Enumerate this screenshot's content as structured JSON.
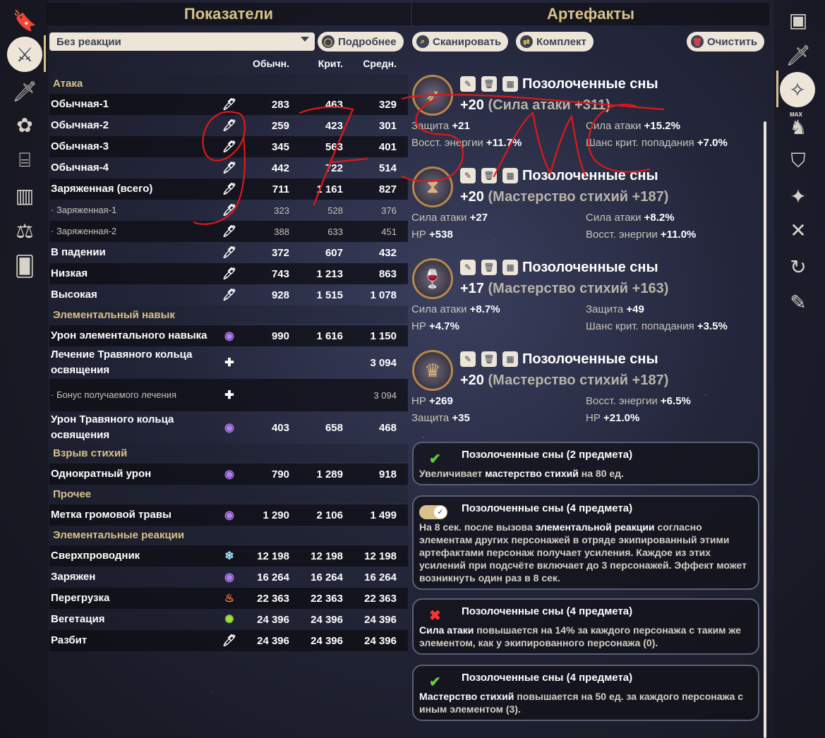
{
  "headers": {
    "stats": "Показатели",
    "artifacts": "Артефакты"
  },
  "reaction_select": {
    "value": "Без реакции"
  },
  "buttons": {
    "details": "Подробнее",
    "scan": "Сканировать",
    "set": "Комплект",
    "clear": "Очистить"
  },
  "columns": {
    "normal": "Обычн.",
    "crit": "Крит.",
    "avg": "Средн."
  },
  "sections": {
    "attack": "Атака",
    "skill": "Элементальный навык",
    "burst": "Взрыв стихий",
    "other": "Прочее",
    "reactions": "Элементальные реакции"
  },
  "attack_rows": [
    {
      "label": "Обычная-1",
      "icon": "sword-icon",
      "n": "283",
      "c": "463",
      "a": "329"
    },
    {
      "label": "Обычная-2",
      "icon": "sword-icon",
      "n": "259",
      "c": "423",
      "a": "301"
    },
    {
      "label": "Обычная-3",
      "icon": "sword-icon",
      "n": "345",
      "c": "563",
      "a": "401"
    },
    {
      "label": "Обычная-4",
      "icon": "sword-icon",
      "n": "442",
      "c": "722",
      "a": "514"
    },
    {
      "label": "Заряженная (всего)",
      "icon": "sword-icon",
      "n": "711",
      "c": "1 161",
      "a": "827"
    },
    {
      "label": "· Заряженная-1",
      "icon": "sword-icon",
      "n": "323",
      "c": "528",
      "a": "376"
    },
    {
      "label": "· Заряженная-2",
      "icon": "sword-icon",
      "n": "388",
      "c": "633",
      "a": "451"
    },
    {
      "label": "В падении",
      "icon": "sword-icon",
      "n": "372",
      "c": "607",
      "a": "432"
    },
    {
      "label": "Низкая",
      "icon": "sword-icon",
      "n": "743",
      "c": "1 213",
      "a": "863"
    },
    {
      "label": "Высокая",
      "icon": "sword-icon",
      "n": "928",
      "c": "1 515",
      "a": "1 078"
    }
  ],
  "skill_rows": [
    {
      "label": "Урон элементального навыка",
      "icon": "electro-icon",
      "n": "990",
      "c": "1 616",
      "a": "1 150"
    },
    {
      "label": "Лечение Травяного кольца освящения",
      "icon": "heal-icon",
      "n": "",
      "c": "",
      "a": "3 094"
    },
    {
      "label": "· Бонус получаемого лечения",
      "icon": "heal-icon",
      "n": "",
      "c": "",
      "a": "3 094"
    },
    {
      "label": "Урон Травяного кольца освящения",
      "icon": "electro-icon",
      "n": "403",
      "c": "658",
      "a": "468"
    }
  ],
  "burst_rows": [
    {
      "label": "Однократный урон",
      "icon": "electro-icon",
      "n": "790",
      "c": "1 289",
      "a": "918"
    }
  ],
  "other_rows": [
    {
      "label": "Метка громовой травы",
      "icon": "electro-icon",
      "n": "1 290",
      "c": "2 106",
      "a": "1 499"
    }
  ],
  "reaction_rows": [
    {
      "label": "Сверхпроводник",
      "icon": "cryo-icon",
      "n": "12 198",
      "c": "12 198",
      "a": "12 198"
    },
    {
      "label": "Заряжен",
      "icon": "electro-icon",
      "n": "16 264",
      "c": "16 264",
      "a": "16 264"
    },
    {
      "label": "Перегрузка",
      "icon": "pyro-icon",
      "n": "22 363",
      "c": "22 363",
      "a": "22 363"
    },
    {
      "label": "Вегетация",
      "icon": "dendro-icon",
      "n": "24 396",
      "c": "24 396",
      "a": "24 396"
    },
    {
      "label": "Разбит",
      "icon": "sword-icon",
      "n": "24 396",
      "c": "24 396",
      "a": "24 396"
    }
  ],
  "artifacts": [
    {
      "name": "Позолоченные сны",
      "level": "+20",
      "main": "(Сила атаки +311)",
      "icon": "plume-icon",
      "subs": [
        [
          "Защита",
          "+21"
        ],
        [
          "Сила атаки",
          "+15.2%"
        ],
        [
          "Восст. энергии",
          "+11.7%"
        ],
        [
          "Шанс крит. попадания",
          "+7.0%"
        ]
      ]
    },
    {
      "name": "Позолоченные сны",
      "level": "+20",
      "main": "(Мастерство стихий +187)",
      "icon": "sands-icon",
      "subs": [
        [
          "Сила атаки",
          "+27"
        ],
        [
          "Сила атаки",
          "+8.2%"
        ],
        [
          "HP",
          "+538"
        ],
        [
          "Восст. энергии",
          "+11.0%"
        ]
      ]
    },
    {
      "name": "Позолоченные сны",
      "level": "+17",
      "main": "(Мастерство стихий +163)",
      "icon": "goblet-icon",
      "subs": [
        [
          "Сила атаки",
          "+8.7%"
        ],
        [
          "Защита",
          "+49"
        ],
        [
          "HP",
          "+4.7%"
        ],
        [
          "Шанс крит. попадания",
          "+3.5%"
        ]
      ]
    },
    {
      "name": "Позолоченные сны",
      "level": "+20",
      "main": "(Мастерство стихий +187)",
      "icon": "circlet-icon",
      "subs": [
        [
          "HP",
          "+269"
        ],
        [
          "Восст. энергии",
          "+6.5%"
        ],
        [
          "Защита",
          "+35"
        ],
        [
          "HP",
          "+21.0%"
        ]
      ]
    }
  ],
  "set_bonuses": [
    {
      "title": "Позолоченные сны (2 предмета)",
      "state": "check",
      "text_html": "Увеличивает <b>мастерство стихий</b> на 80 ед."
    },
    {
      "title": "Позолоченные сны (4 предмета)",
      "state": "toggle",
      "text_html": "На 8 сек. после вызова <b>элементальной реакции</b> согласно элементам других персонажей в отряде экипированный этими артефактами персонаж получает усиления. Каждое из этих усилений при подсчёте включает до 3 персонажей. Эффект может возникнуть один раз в 8 сек."
    },
    {
      "title": "Позолоченные сны (4 предмета)",
      "state": "cross",
      "text_html": "<b>Сила атаки</b> повышается на 14% за каждого персонажа с таким же элементом, как у экипированного персонажа (0)."
    },
    {
      "title": "Позолоченные сны (4 предмета)",
      "state": "check",
      "text_html": "<b>Мастерство стихий</b> повышается на 50 ед. за каждого персонажа с иным элементом (3)."
    }
  ],
  "right_sidebar": {
    "max_label": "MAX"
  },
  "colors": {
    "gold": "#d9c189",
    "cream": "#ece5d8",
    "handwriting": "#e01818"
  }
}
